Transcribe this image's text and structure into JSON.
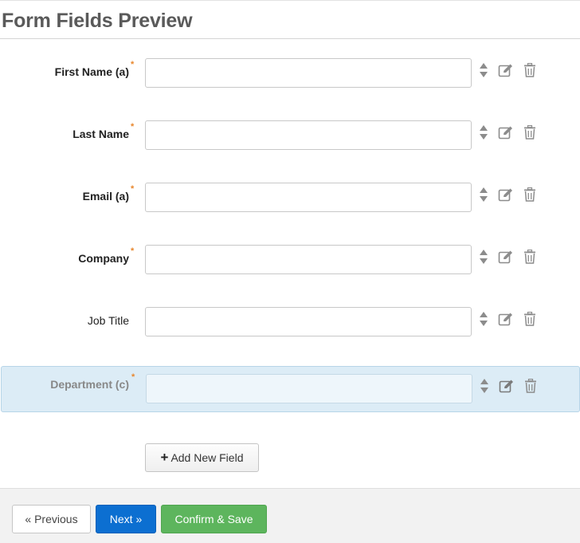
{
  "header": {
    "title": "Form Fields Preview"
  },
  "fields": [
    {
      "label": "First Name (a)",
      "required": true,
      "value": ""
    },
    {
      "label": "Last Name",
      "required": true,
      "value": ""
    },
    {
      "label": "Email (a)",
      "required": true,
      "value": ""
    },
    {
      "label": "Company",
      "required": true,
      "value": ""
    },
    {
      "label": "Job Title",
      "required": false,
      "value": ""
    },
    {
      "label": "Department (c)",
      "required": true,
      "value": "",
      "selected": true
    }
  ],
  "required_marker": "*",
  "icons": {
    "reorder": "sort-arrows-icon",
    "edit": "edit-icon",
    "delete": "trash-icon"
  },
  "add_field": {
    "icon": "plus-icon",
    "label": "Add New Field"
  },
  "footer": {
    "previous_label": "« Previous",
    "next_label": "Next »",
    "confirm_label": "Confirm & Save"
  },
  "colors": {
    "required_marker": "#e8872d",
    "selected_row_bg": "#dcecf6",
    "next_button": "#0c6fd1",
    "confirm_button": "#5db55d"
  }
}
